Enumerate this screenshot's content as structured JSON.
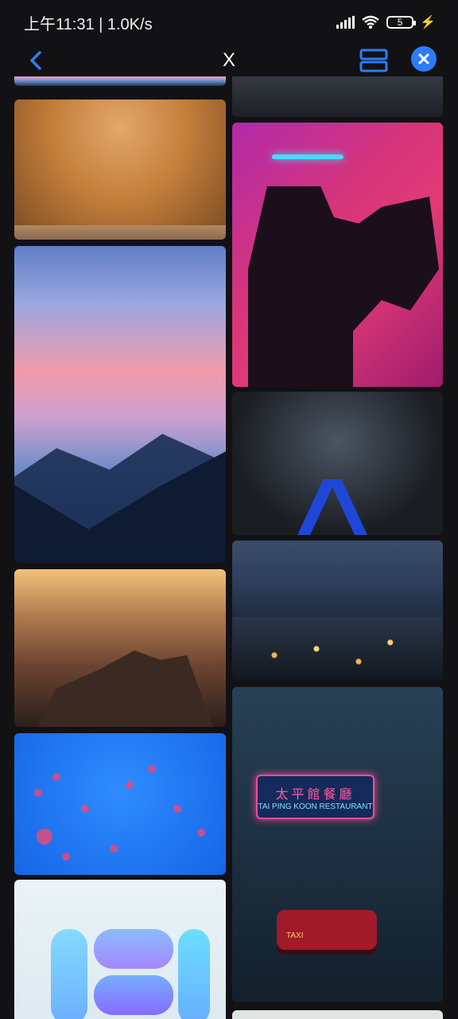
{
  "status_bar": {
    "left_text": "上午11:31 | 1.0K/s",
    "battery_level": "5",
    "signal_icon": "signal-icon",
    "wifi_icon": "wifi-icon",
    "charging_icon": "charging-icon"
  },
  "app_bar": {
    "title": "X",
    "back_icon": "chevron-left-icon",
    "layout_icon": "layout-rows-icon",
    "close_icon": "close-icon",
    "accent_color": "#2d7cf6"
  },
  "gallery": {
    "tiles": [
      {
        "name": "sandstone-cave-photo"
      },
      {
        "name": "pink-sunset-mountains-photo"
      },
      {
        "name": "desert-rock-landscape-photo"
      },
      {
        "name": "jellyfish-blue-photo"
      },
      {
        "name": "glass-logo-render-photo"
      },
      {
        "name": "dark-ocean-photo"
      },
      {
        "name": "neon-camera-operator-photo"
      },
      {
        "name": "subway-tunnel-photo"
      },
      {
        "name": "city-night-photo"
      },
      {
        "name": "tai-ping-koon-street-photo",
        "sign_cn": "太平館餐廳",
        "sign_en": "TAI PING KOON RESTAURANT",
        "taxi_label": "TAXI"
      },
      {
        "name": "partial-bottom-photo"
      }
    ]
  }
}
